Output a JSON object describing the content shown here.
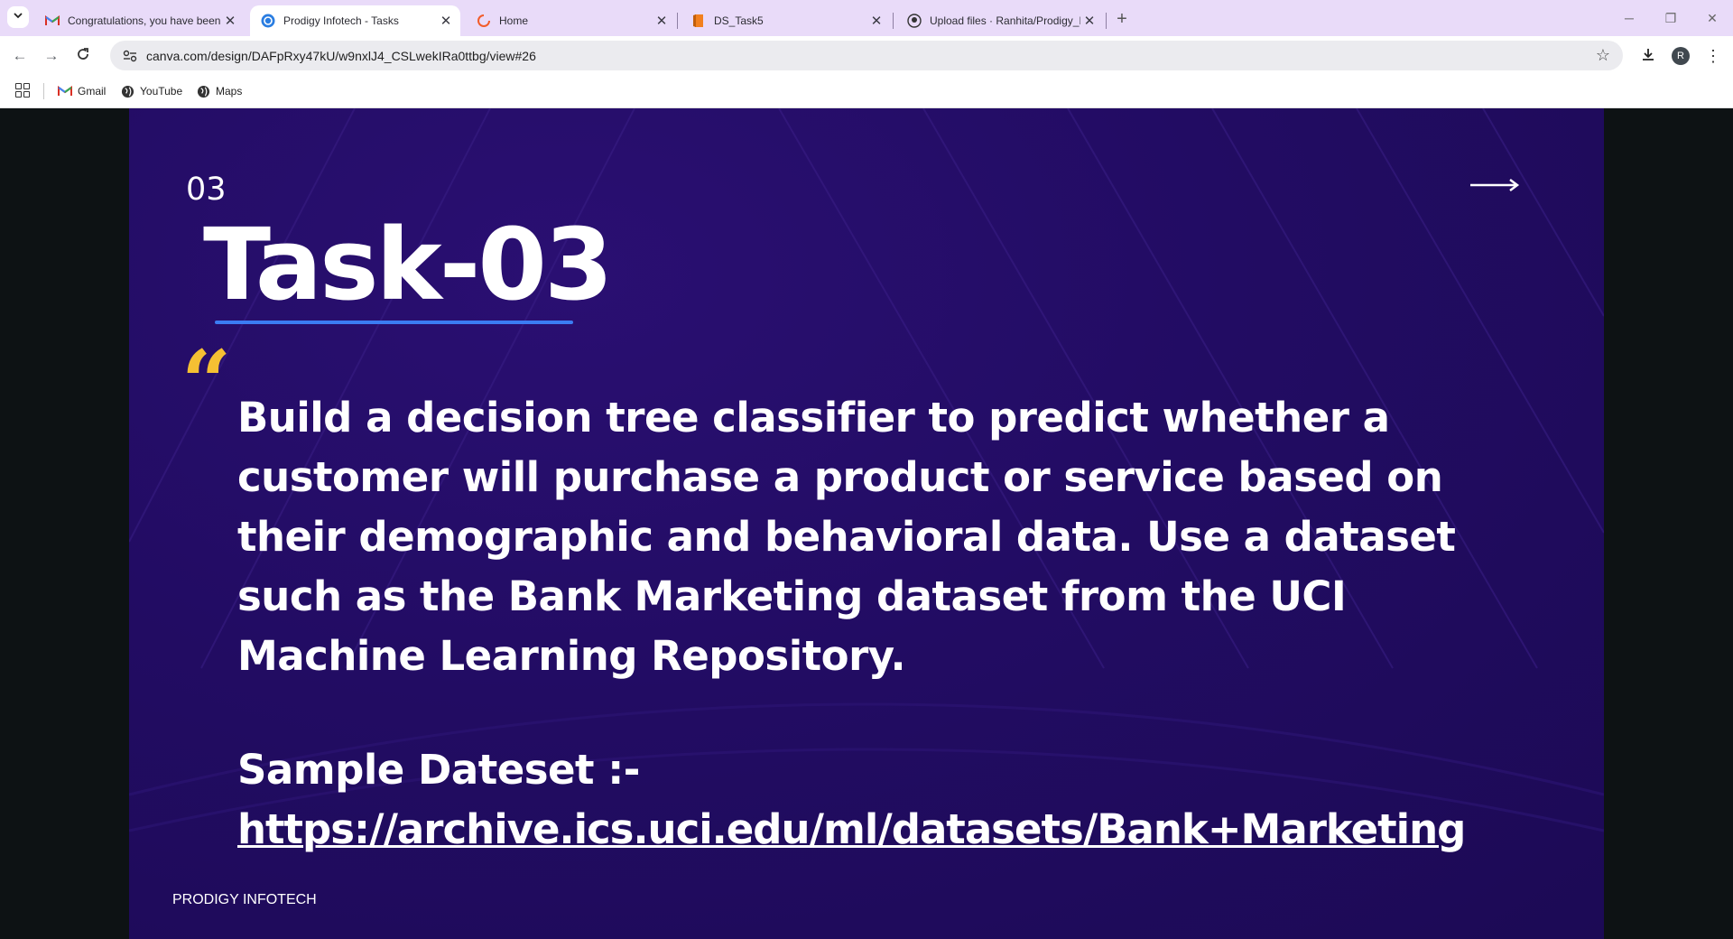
{
  "tabs": [
    {
      "title": "Congratulations, you have been",
      "icon": "gmail-icon",
      "active": false
    },
    {
      "title": "Prodigy Infotech - Tasks",
      "icon": "canva-icon",
      "active": true
    },
    {
      "title": "Home",
      "icon": "loading-icon",
      "active": false
    },
    {
      "title": "DS_Task5",
      "icon": "notebook-icon",
      "active": false
    },
    {
      "title": "Upload files · Ranhita/Prodigy_I",
      "icon": "github-icon",
      "active": false
    }
  ],
  "address_bar": {
    "url": "canva.com/design/DAFpRxy47kU/w9nxlJ4_CSLwekIRa0ttbg/view#26"
  },
  "profile": {
    "initial": "R"
  },
  "bookmarks": [
    {
      "label": "Gmail",
      "icon": "gmail-icon"
    },
    {
      "label": "YouTube",
      "icon": "globe-icon"
    },
    {
      "label": "Maps",
      "icon": "globe-icon"
    }
  ],
  "slide": {
    "number": "03",
    "title": "Task-03",
    "description": "Build a decision tree classifier to predict whether a customer will purchase a product or service based on their demographic and behavioral data. Use a dataset such as the Bank Marketing dataset from the UCI Machine Learning Repository.",
    "sample_label": "Sample Dateset :-",
    "sample_link": "https://archive.ics.uci.edu/ml/datasets/Bank+Marketing",
    "footer": "PRODIGY INFOTECH"
  },
  "colors": {
    "slide_bg": "#220c63",
    "accent_blue": "#3b7cf3",
    "quote_yellow": "#f5c033",
    "tabstrip": "#e9dbf9"
  }
}
